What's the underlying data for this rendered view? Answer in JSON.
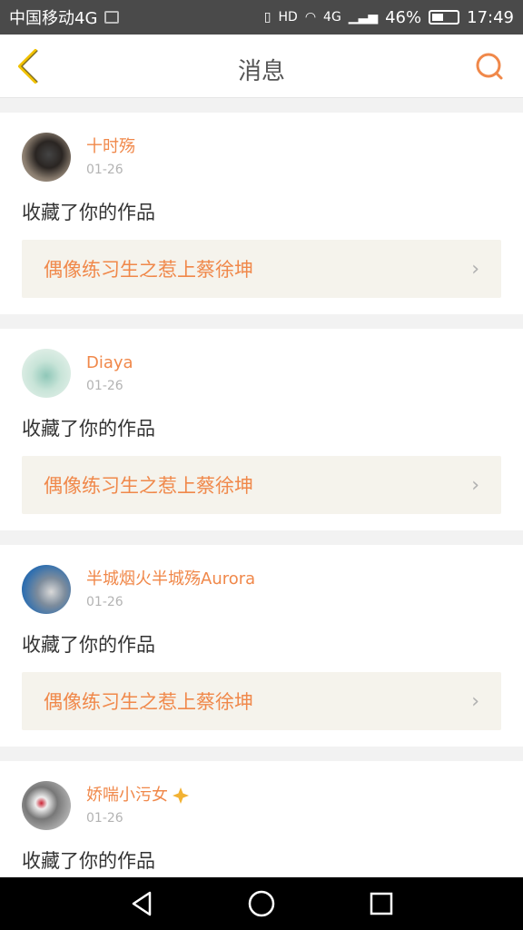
{
  "status_bar": {
    "carrier": "中国移动4G",
    "battery": "46%",
    "battery_level": 0.46,
    "network": "4G",
    "time": "17:49"
  },
  "header": {
    "title": "消息"
  },
  "messages": [
    {
      "user": "十时殇",
      "date": "01-26",
      "action": "收藏了你的作品",
      "work_title": "偶像练习生之惹上蔡徐坤"
    },
    {
      "user": "Diaya",
      "date": "01-26",
      "action": "收藏了你的作品",
      "work_title": "偶像练习生之惹上蔡徐坤"
    },
    {
      "user": "半城烟火半城殇Aurora",
      "date": "01-26",
      "action": "收藏了你的作品",
      "work_title": "偶像练习生之惹上蔡徐坤"
    },
    {
      "user": "娇喘小污女",
      "date": "01-26",
      "action": "收藏了你的作品"
    }
  ],
  "colors": {
    "accent": "#f0884a",
    "back_icon": "#f2c200"
  },
  "icons": [
    "back-arrow-icon",
    "search-icon",
    "chevron-right-icon",
    "sparkle-icon",
    "nav-back-icon",
    "nav-home-icon",
    "nav-recents-icon"
  ]
}
